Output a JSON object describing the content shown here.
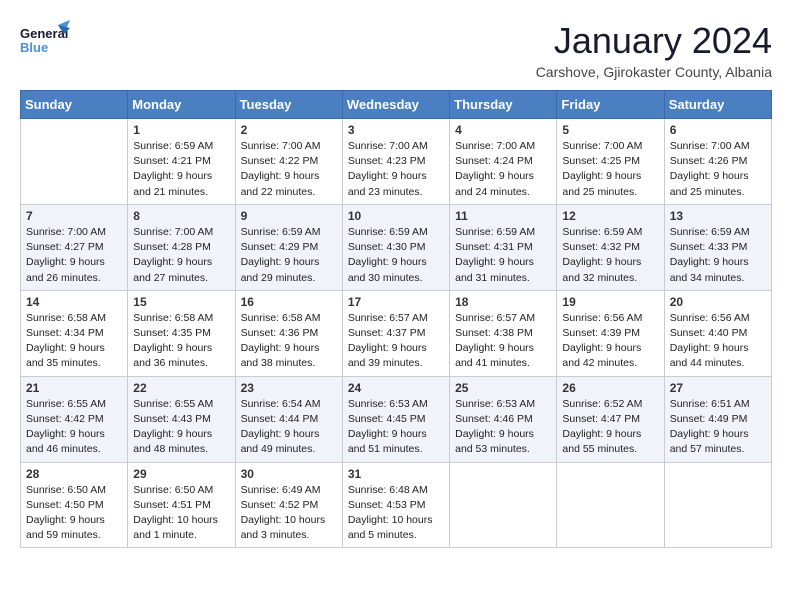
{
  "logo": {
    "text_general": "General",
    "text_blue": "Blue"
  },
  "header": {
    "month": "January 2024",
    "location": "Carshove, Gjirokaster County, Albania"
  },
  "weekdays": [
    "Sunday",
    "Monday",
    "Tuesday",
    "Wednesday",
    "Thursday",
    "Friday",
    "Saturday"
  ],
  "weeks": [
    [
      {
        "day": "",
        "sunrise": "",
        "sunset": "",
        "daylight": ""
      },
      {
        "day": "1",
        "sunrise": "Sunrise: 6:59 AM",
        "sunset": "Sunset: 4:21 PM",
        "daylight": "Daylight: 9 hours and 21 minutes."
      },
      {
        "day": "2",
        "sunrise": "Sunrise: 7:00 AM",
        "sunset": "Sunset: 4:22 PM",
        "daylight": "Daylight: 9 hours and 22 minutes."
      },
      {
        "day": "3",
        "sunrise": "Sunrise: 7:00 AM",
        "sunset": "Sunset: 4:23 PM",
        "daylight": "Daylight: 9 hours and 23 minutes."
      },
      {
        "day": "4",
        "sunrise": "Sunrise: 7:00 AM",
        "sunset": "Sunset: 4:24 PM",
        "daylight": "Daylight: 9 hours and 24 minutes."
      },
      {
        "day": "5",
        "sunrise": "Sunrise: 7:00 AM",
        "sunset": "Sunset: 4:25 PM",
        "daylight": "Daylight: 9 hours and 25 minutes."
      },
      {
        "day": "6",
        "sunrise": "Sunrise: 7:00 AM",
        "sunset": "Sunset: 4:26 PM",
        "daylight": "Daylight: 9 hours and 25 minutes."
      }
    ],
    [
      {
        "day": "7",
        "sunrise": "Sunrise: 7:00 AM",
        "sunset": "Sunset: 4:27 PM",
        "daylight": "Daylight: 9 hours and 26 minutes."
      },
      {
        "day": "8",
        "sunrise": "Sunrise: 7:00 AM",
        "sunset": "Sunset: 4:28 PM",
        "daylight": "Daylight: 9 hours and 27 minutes."
      },
      {
        "day": "9",
        "sunrise": "Sunrise: 6:59 AM",
        "sunset": "Sunset: 4:29 PM",
        "daylight": "Daylight: 9 hours and 29 minutes."
      },
      {
        "day": "10",
        "sunrise": "Sunrise: 6:59 AM",
        "sunset": "Sunset: 4:30 PM",
        "daylight": "Daylight: 9 hours and 30 minutes."
      },
      {
        "day": "11",
        "sunrise": "Sunrise: 6:59 AM",
        "sunset": "Sunset: 4:31 PM",
        "daylight": "Daylight: 9 hours and 31 minutes."
      },
      {
        "day": "12",
        "sunrise": "Sunrise: 6:59 AM",
        "sunset": "Sunset: 4:32 PM",
        "daylight": "Daylight: 9 hours and 32 minutes."
      },
      {
        "day": "13",
        "sunrise": "Sunrise: 6:59 AM",
        "sunset": "Sunset: 4:33 PM",
        "daylight": "Daylight: 9 hours and 34 minutes."
      }
    ],
    [
      {
        "day": "14",
        "sunrise": "Sunrise: 6:58 AM",
        "sunset": "Sunset: 4:34 PM",
        "daylight": "Daylight: 9 hours and 35 minutes."
      },
      {
        "day": "15",
        "sunrise": "Sunrise: 6:58 AM",
        "sunset": "Sunset: 4:35 PM",
        "daylight": "Daylight: 9 hours and 36 minutes."
      },
      {
        "day": "16",
        "sunrise": "Sunrise: 6:58 AM",
        "sunset": "Sunset: 4:36 PM",
        "daylight": "Daylight: 9 hours and 38 minutes."
      },
      {
        "day": "17",
        "sunrise": "Sunrise: 6:57 AM",
        "sunset": "Sunset: 4:37 PM",
        "daylight": "Daylight: 9 hours and 39 minutes."
      },
      {
        "day": "18",
        "sunrise": "Sunrise: 6:57 AM",
        "sunset": "Sunset: 4:38 PM",
        "daylight": "Daylight: 9 hours and 41 minutes."
      },
      {
        "day": "19",
        "sunrise": "Sunrise: 6:56 AM",
        "sunset": "Sunset: 4:39 PM",
        "daylight": "Daylight: 9 hours and 42 minutes."
      },
      {
        "day": "20",
        "sunrise": "Sunrise: 6:56 AM",
        "sunset": "Sunset: 4:40 PM",
        "daylight": "Daylight: 9 hours and 44 minutes."
      }
    ],
    [
      {
        "day": "21",
        "sunrise": "Sunrise: 6:55 AM",
        "sunset": "Sunset: 4:42 PM",
        "daylight": "Daylight: 9 hours and 46 minutes."
      },
      {
        "day": "22",
        "sunrise": "Sunrise: 6:55 AM",
        "sunset": "Sunset: 4:43 PM",
        "daylight": "Daylight: 9 hours and 48 minutes."
      },
      {
        "day": "23",
        "sunrise": "Sunrise: 6:54 AM",
        "sunset": "Sunset: 4:44 PM",
        "daylight": "Daylight: 9 hours and 49 minutes."
      },
      {
        "day": "24",
        "sunrise": "Sunrise: 6:53 AM",
        "sunset": "Sunset: 4:45 PM",
        "daylight": "Daylight: 9 hours and 51 minutes."
      },
      {
        "day": "25",
        "sunrise": "Sunrise: 6:53 AM",
        "sunset": "Sunset: 4:46 PM",
        "daylight": "Daylight: 9 hours and 53 minutes."
      },
      {
        "day": "26",
        "sunrise": "Sunrise: 6:52 AM",
        "sunset": "Sunset: 4:47 PM",
        "daylight": "Daylight: 9 hours and 55 minutes."
      },
      {
        "day": "27",
        "sunrise": "Sunrise: 6:51 AM",
        "sunset": "Sunset: 4:49 PM",
        "daylight": "Daylight: 9 hours and 57 minutes."
      }
    ],
    [
      {
        "day": "28",
        "sunrise": "Sunrise: 6:50 AM",
        "sunset": "Sunset: 4:50 PM",
        "daylight": "Daylight: 9 hours and 59 minutes."
      },
      {
        "day": "29",
        "sunrise": "Sunrise: 6:50 AM",
        "sunset": "Sunset: 4:51 PM",
        "daylight": "Daylight: 10 hours and 1 minute."
      },
      {
        "day": "30",
        "sunrise": "Sunrise: 6:49 AM",
        "sunset": "Sunset: 4:52 PM",
        "daylight": "Daylight: 10 hours and 3 minutes."
      },
      {
        "day": "31",
        "sunrise": "Sunrise: 6:48 AM",
        "sunset": "Sunset: 4:53 PM",
        "daylight": "Daylight: 10 hours and 5 minutes."
      },
      {
        "day": "",
        "sunrise": "",
        "sunset": "",
        "daylight": ""
      },
      {
        "day": "",
        "sunrise": "",
        "sunset": "",
        "daylight": ""
      },
      {
        "day": "",
        "sunrise": "",
        "sunset": "",
        "daylight": ""
      }
    ]
  ]
}
